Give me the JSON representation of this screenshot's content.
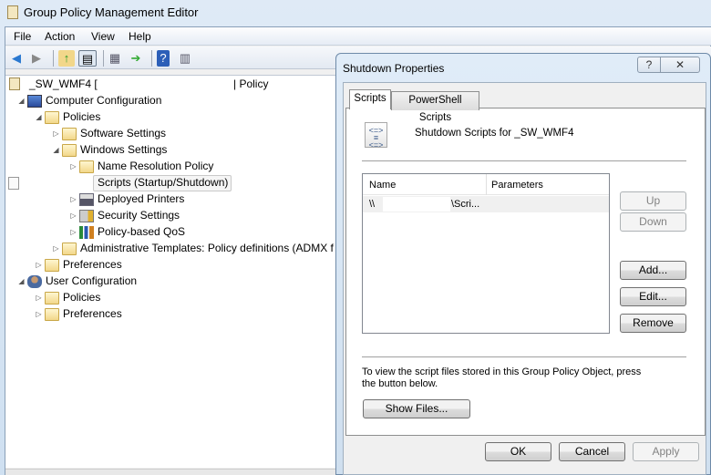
{
  "window": {
    "title": "Group Policy Management Editor"
  },
  "menu": [
    "File",
    "Action",
    "View",
    "Help"
  ],
  "toolbar": [
    "back-icon",
    "forward-icon",
    "up-folder-icon",
    "show-hide-tree-icon",
    "properties-icon",
    "export-list-icon",
    "help-icon",
    "show-action-pane-icon"
  ],
  "tree": {
    "root": "_SW_WMF4 [",
    "root_suffix": "| Policy",
    "items": [
      {
        "label": "Computer Configuration",
        "level": 1,
        "expand": "open",
        "icon": "computer-icon"
      },
      {
        "label": "Policies",
        "level": 2,
        "expand": "open",
        "icon": "folder-icon"
      },
      {
        "label": "Software Settings",
        "level": 3,
        "expand": "closed",
        "icon": "folder-icon"
      },
      {
        "label": "Windows Settings",
        "level": 3,
        "expand": "open",
        "icon": "folder-icon"
      },
      {
        "label": "Name Resolution Policy",
        "level": 4,
        "expand": "closed",
        "icon": "folder-icon"
      },
      {
        "label": "Scripts (Startup/Shutdown)",
        "level": 4,
        "expand": "none",
        "icon": "script-icon",
        "selected": true
      },
      {
        "label": "Deployed Printers",
        "level": 4,
        "expand": "closed",
        "icon": "printer-icon"
      },
      {
        "label": "Security Settings",
        "level": 4,
        "expand": "closed",
        "icon": "security-icon"
      },
      {
        "label": "Policy-based QoS",
        "level": 4,
        "expand": "closed",
        "icon": "chart-icon"
      },
      {
        "label": "Administrative Templates: Policy definitions (ADMX f",
        "level": 3,
        "expand": "closed",
        "icon": "folder-icon"
      },
      {
        "label": "Preferences",
        "level": 2,
        "expand": "closed",
        "icon": "folder-icon"
      },
      {
        "label": "User Configuration",
        "level": 1,
        "expand": "open",
        "icon": "user-icon"
      },
      {
        "label": "Policies",
        "level": 2,
        "expand": "closed",
        "icon": "folder-icon"
      },
      {
        "label": "Preferences",
        "level": 2,
        "expand": "closed",
        "icon": "folder-icon"
      }
    ]
  },
  "dialog": {
    "title": "Shutdown Properties",
    "help": "?",
    "close": "✕",
    "tabs": [
      "Scripts",
      "PowerShell Scripts"
    ],
    "heading": "Shutdown Scripts for _SW_WMF4",
    "columns": [
      "Name",
      "Parameters"
    ],
    "rows": [
      {
        "name_start": "\\\\",
        "name_end": "\\Scri...",
        "parameters": ""
      }
    ],
    "buttons": {
      "up": "Up",
      "down": "Down",
      "add": "Add...",
      "edit": "Edit...",
      "remove": "Remove",
      "show_files": "Show Files...",
      "ok": "OK",
      "cancel": "Cancel",
      "apply": "Apply"
    },
    "info": "To view the script files stored in this Group Policy Object, press the button below."
  }
}
